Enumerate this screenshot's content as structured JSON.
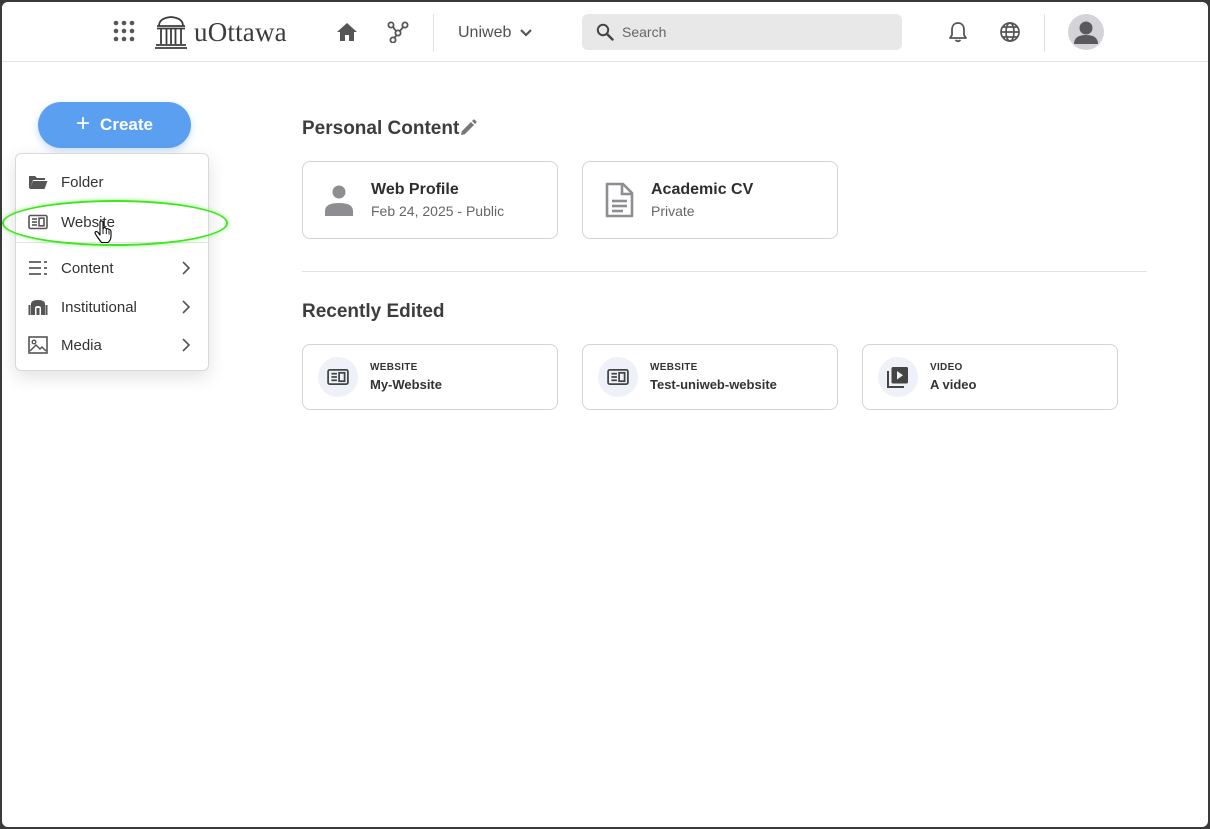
{
  "header": {
    "logo_text": "uOttawa",
    "workspace_label": "Uniweb",
    "search_placeholder": "Search"
  },
  "create_button": {
    "label": "Create"
  },
  "create_menu": {
    "items": [
      {
        "label": "Folder",
        "icon": "folder-open-icon",
        "has_submenu": false
      },
      {
        "label": "Website",
        "icon": "website-icon",
        "has_submenu": false,
        "highlighted": true
      },
      {
        "label": "Content",
        "icon": "list-icon",
        "has_submenu": true
      },
      {
        "label": "Institutional",
        "icon": "institution-icon",
        "has_submenu": true
      },
      {
        "label": "Media",
        "icon": "image-icon",
        "has_submenu": true
      }
    ]
  },
  "personal_content": {
    "title": "Personal Content",
    "cards": [
      {
        "title": "Web Profile",
        "subtitle": "Feb 24, 2025 - Public",
        "icon": "person-icon"
      },
      {
        "title": "Academic CV",
        "subtitle": "Private",
        "icon": "document-icon"
      }
    ]
  },
  "recently_edited": {
    "title": "Recently Edited",
    "cards": [
      {
        "type": "WEBSITE",
        "name": "My-Website",
        "icon": "website-icon"
      },
      {
        "type": "WEBSITE",
        "name": "Test-uniweb-website",
        "icon": "website-icon"
      },
      {
        "type": "VIDEO",
        "name": "A video",
        "icon": "video-library-icon"
      }
    ]
  },
  "colors": {
    "accent": "#5b9ff0",
    "highlight_ring": "#3ee61e",
    "icon_gray": "#555555"
  }
}
